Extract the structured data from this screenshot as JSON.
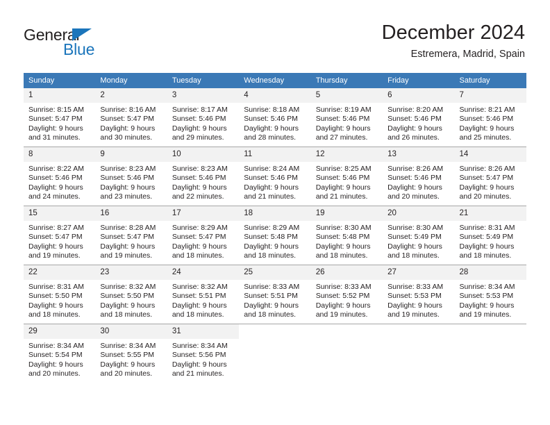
{
  "brand": {
    "name_top": "General",
    "name_bottom": "Blue",
    "triangle_color": "#1b75bb",
    "text_color": "#221f1f"
  },
  "header": {
    "title": "December 2024",
    "location": "Estremera, Madrid, Spain"
  },
  "theme": {
    "header_bg": "#3b79b6",
    "header_text": "#ffffff",
    "daynum_bg": "#f2f2f2",
    "cell_bg": "#ffffff",
    "grid_line": "#a6a6a6",
    "body_text": "#231f20"
  },
  "columns": [
    "Sunday",
    "Monday",
    "Tuesday",
    "Wednesday",
    "Thursday",
    "Friday",
    "Saturday"
  ],
  "labels": {
    "sunrise_prefix": "Sunrise:",
    "sunset_prefix": "Sunset:",
    "daylight_prefix": "Daylight:"
  },
  "weeks": [
    [
      {
        "day": "1",
        "l1": "Sunrise: 8:15 AM",
        "l2": "Sunset: 5:47 PM",
        "l3": "Daylight: 9 hours",
        "l4": "and 31 minutes."
      },
      {
        "day": "2",
        "l1": "Sunrise: 8:16 AM",
        "l2": "Sunset: 5:47 PM",
        "l3": "Daylight: 9 hours",
        "l4": "and 30 minutes."
      },
      {
        "day": "3",
        "l1": "Sunrise: 8:17 AM",
        "l2": "Sunset: 5:46 PM",
        "l3": "Daylight: 9 hours",
        "l4": "and 29 minutes."
      },
      {
        "day": "4",
        "l1": "Sunrise: 8:18 AM",
        "l2": "Sunset: 5:46 PM",
        "l3": "Daylight: 9 hours",
        "l4": "and 28 minutes."
      },
      {
        "day": "5",
        "l1": "Sunrise: 8:19 AM",
        "l2": "Sunset: 5:46 PM",
        "l3": "Daylight: 9 hours",
        "l4": "and 27 minutes."
      },
      {
        "day": "6",
        "l1": "Sunrise: 8:20 AM",
        "l2": "Sunset: 5:46 PM",
        "l3": "Daylight: 9 hours",
        "l4": "and 26 minutes."
      },
      {
        "day": "7",
        "l1": "Sunrise: 8:21 AM",
        "l2": "Sunset: 5:46 PM",
        "l3": "Daylight: 9 hours",
        "l4": "and 25 minutes."
      }
    ],
    [
      {
        "day": "8",
        "l1": "Sunrise: 8:22 AM",
        "l2": "Sunset: 5:46 PM",
        "l3": "Daylight: 9 hours",
        "l4": "and 24 minutes."
      },
      {
        "day": "9",
        "l1": "Sunrise: 8:23 AM",
        "l2": "Sunset: 5:46 PM",
        "l3": "Daylight: 9 hours",
        "l4": "and 23 minutes."
      },
      {
        "day": "10",
        "l1": "Sunrise: 8:23 AM",
        "l2": "Sunset: 5:46 PM",
        "l3": "Daylight: 9 hours",
        "l4": "and 22 minutes."
      },
      {
        "day": "11",
        "l1": "Sunrise: 8:24 AM",
        "l2": "Sunset: 5:46 PM",
        "l3": "Daylight: 9 hours",
        "l4": "and 21 minutes."
      },
      {
        "day": "12",
        "l1": "Sunrise: 8:25 AM",
        "l2": "Sunset: 5:46 PM",
        "l3": "Daylight: 9 hours",
        "l4": "and 21 minutes."
      },
      {
        "day": "13",
        "l1": "Sunrise: 8:26 AM",
        "l2": "Sunset: 5:46 PM",
        "l3": "Daylight: 9 hours",
        "l4": "and 20 minutes."
      },
      {
        "day": "14",
        "l1": "Sunrise: 8:26 AM",
        "l2": "Sunset: 5:47 PM",
        "l3": "Daylight: 9 hours",
        "l4": "and 20 minutes."
      }
    ],
    [
      {
        "day": "15",
        "l1": "Sunrise: 8:27 AM",
        "l2": "Sunset: 5:47 PM",
        "l3": "Daylight: 9 hours",
        "l4": "and 19 minutes."
      },
      {
        "day": "16",
        "l1": "Sunrise: 8:28 AM",
        "l2": "Sunset: 5:47 PM",
        "l3": "Daylight: 9 hours",
        "l4": "and 19 minutes."
      },
      {
        "day": "17",
        "l1": "Sunrise: 8:29 AM",
        "l2": "Sunset: 5:47 PM",
        "l3": "Daylight: 9 hours",
        "l4": "and 18 minutes."
      },
      {
        "day": "18",
        "l1": "Sunrise: 8:29 AM",
        "l2": "Sunset: 5:48 PM",
        "l3": "Daylight: 9 hours",
        "l4": "and 18 minutes."
      },
      {
        "day": "19",
        "l1": "Sunrise: 8:30 AM",
        "l2": "Sunset: 5:48 PM",
        "l3": "Daylight: 9 hours",
        "l4": "and 18 minutes."
      },
      {
        "day": "20",
        "l1": "Sunrise: 8:30 AM",
        "l2": "Sunset: 5:49 PM",
        "l3": "Daylight: 9 hours",
        "l4": "and 18 minutes."
      },
      {
        "day": "21",
        "l1": "Sunrise: 8:31 AM",
        "l2": "Sunset: 5:49 PM",
        "l3": "Daylight: 9 hours",
        "l4": "and 18 minutes."
      }
    ],
    [
      {
        "day": "22",
        "l1": "Sunrise: 8:31 AM",
        "l2": "Sunset: 5:50 PM",
        "l3": "Daylight: 9 hours",
        "l4": "and 18 minutes."
      },
      {
        "day": "23",
        "l1": "Sunrise: 8:32 AM",
        "l2": "Sunset: 5:50 PM",
        "l3": "Daylight: 9 hours",
        "l4": "and 18 minutes."
      },
      {
        "day": "24",
        "l1": "Sunrise: 8:32 AM",
        "l2": "Sunset: 5:51 PM",
        "l3": "Daylight: 9 hours",
        "l4": "and 18 minutes."
      },
      {
        "day": "25",
        "l1": "Sunrise: 8:33 AM",
        "l2": "Sunset: 5:51 PM",
        "l3": "Daylight: 9 hours",
        "l4": "and 18 minutes."
      },
      {
        "day": "26",
        "l1": "Sunrise: 8:33 AM",
        "l2": "Sunset: 5:52 PM",
        "l3": "Daylight: 9 hours",
        "l4": "and 19 minutes."
      },
      {
        "day": "27",
        "l1": "Sunrise: 8:33 AM",
        "l2": "Sunset: 5:53 PM",
        "l3": "Daylight: 9 hours",
        "l4": "and 19 minutes."
      },
      {
        "day": "28",
        "l1": "Sunrise: 8:34 AM",
        "l2": "Sunset: 5:53 PM",
        "l3": "Daylight: 9 hours",
        "l4": "and 19 minutes."
      }
    ],
    [
      {
        "day": "29",
        "l1": "Sunrise: 8:34 AM",
        "l2": "Sunset: 5:54 PM",
        "l3": "Daylight: 9 hours",
        "l4": "and 20 minutes."
      },
      {
        "day": "30",
        "l1": "Sunrise: 8:34 AM",
        "l2": "Sunset: 5:55 PM",
        "l3": "Daylight: 9 hours",
        "l4": "and 20 minutes."
      },
      {
        "day": "31",
        "l1": "Sunrise: 8:34 AM",
        "l2": "Sunset: 5:56 PM",
        "l3": "Daylight: 9 hours",
        "l4": "and 21 minutes."
      },
      {
        "day": "",
        "l1": "",
        "l2": "",
        "l3": "",
        "l4": ""
      },
      {
        "day": "",
        "l1": "",
        "l2": "",
        "l3": "",
        "l4": ""
      },
      {
        "day": "",
        "l1": "",
        "l2": "",
        "l3": "",
        "l4": ""
      },
      {
        "day": "",
        "l1": "",
        "l2": "",
        "l3": "",
        "l4": ""
      }
    ]
  ]
}
